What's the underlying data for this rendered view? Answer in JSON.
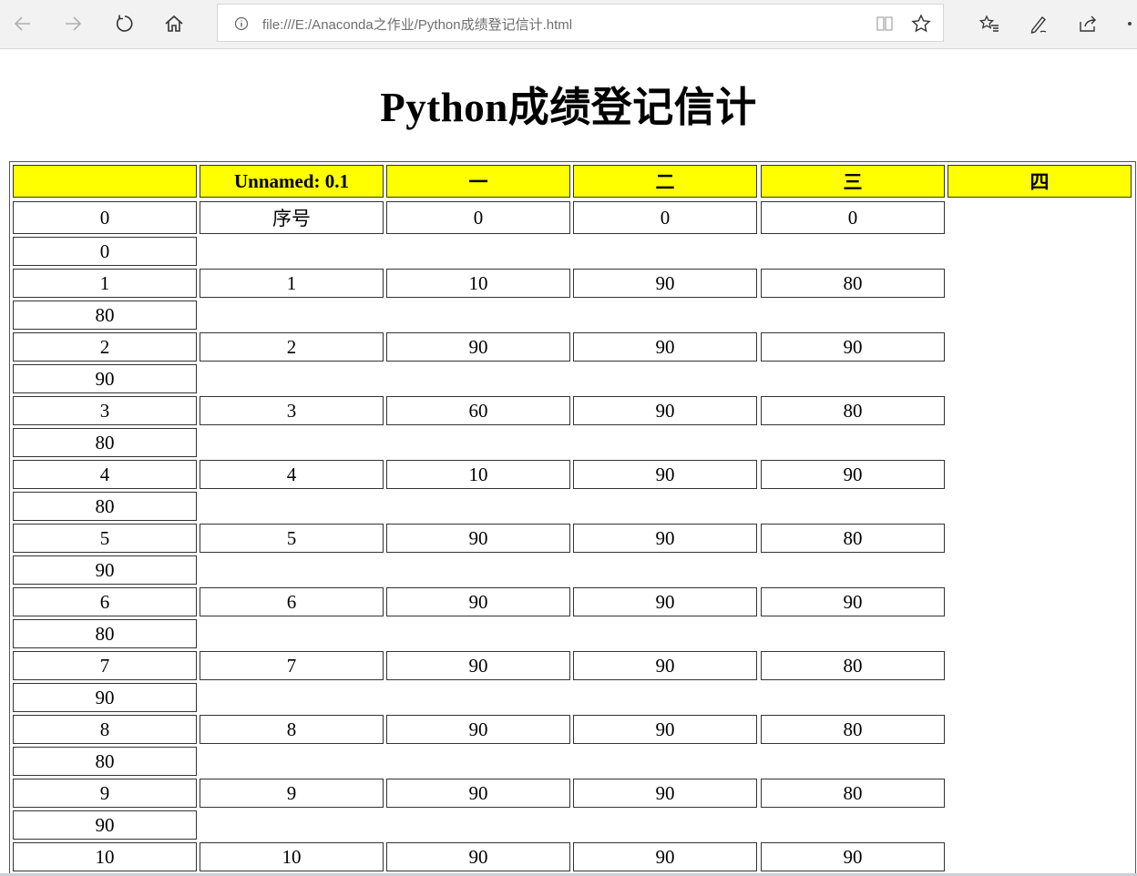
{
  "browser": {
    "url": "file:///E:/Anaconda之作业/Python成绩登记信计.html"
  },
  "page": {
    "title": "Python成绩登记信计"
  },
  "table": {
    "headers": [
      "",
      "Unnamed: 0.1",
      "一",
      "二",
      "三",
      "四"
    ],
    "rows": [
      {
        "cells": [
          "0",
          "序号",
          "0",
          "0",
          "0"
        ],
        "extra": "0"
      },
      {
        "cells": [
          "1",
          "1",
          "10",
          "90",
          "80"
        ],
        "extra": "80"
      },
      {
        "cells": [
          "2",
          "2",
          "90",
          "90",
          "90"
        ],
        "extra": "90"
      },
      {
        "cells": [
          "3",
          "3",
          "60",
          "90",
          "80"
        ],
        "extra": "80"
      },
      {
        "cells": [
          "4",
          "4",
          "10",
          "90",
          "90"
        ],
        "extra": "80"
      },
      {
        "cells": [
          "5",
          "5",
          "90",
          "90",
          "80"
        ],
        "extra": "90"
      },
      {
        "cells": [
          "6",
          "6",
          "90",
          "90",
          "90"
        ],
        "extra": "80"
      },
      {
        "cells": [
          "7",
          "7",
          "90",
          "90",
          "80"
        ],
        "extra": "90"
      },
      {
        "cells": [
          "8",
          "8",
          "90",
          "90",
          "80"
        ],
        "extra": "80"
      },
      {
        "cells": [
          "9",
          "9",
          "90",
          "90",
          "80"
        ],
        "extra": "90"
      },
      {
        "cells": [
          "10",
          "10",
          "90",
          "90",
          "90"
        ],
        "extra": ""
      }
    ]
  },
  "icons": {
    "back": "back-arrow-icon",
    "forward": "forward-arrow-icon",
    "refresh": "refresh-icon",
    "home": "home-icon",
    "info": "info-icon",
    "reading": "reading-view-icon",
    "favorite": "star-icon",
    "favorites_list": "favorites-list-icon",
    "notes": "pen-icon",
    "share": "share-icon"
  },
  "colors": {
    "header_bg": "#ffff00",
    "chrome_bg": "#f2f2f2"
  }
}
